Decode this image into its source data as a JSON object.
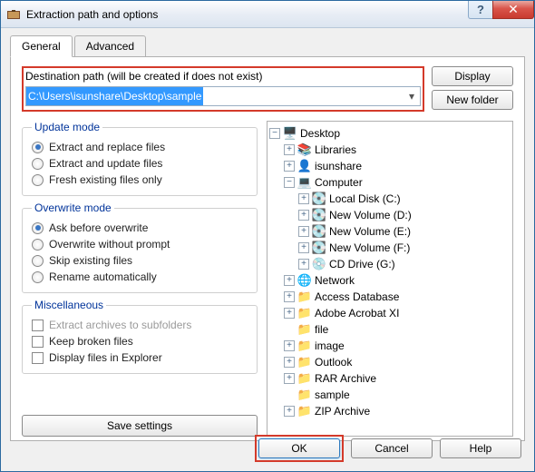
{
  "window": {
    "title": "Extraction path and options"
  },
  "tabs": {
    "general": "General",
    "advanced": "Advanced"
  },
  "dest": {
    "label": "Destination path (will be created if does not exist)",
    "value": "C:\\Users\\isunshare\\Desktop\\sample"
  },
  "buttons": {
    "display": "Display",
    "new_folder": "New folder",
    "save_settings": "Save settings",
    "ok": "OK",
    "cancel": "Cancel",
    "help": "Help"
  },
  "groups": {
    "update": {
      "legend": "Update mode",
      "opt1": "Extract and replace files",
      "opt2": "Extract and update files",
      "opt3": "Fresh existing files only"
    },
    "overwrite": {
      "legend": "Overwrite mode",
      "opt1": "Ask before overwrite",
      "opt2": "Overwrite without prompt",
      "opt3": "Skip existing files",
      "opt4": "Rename automatically"
    },
    "misc": {
      "legend": "Miscellaneous",
      "opt1": "Extract archives to subfolders",
      "opt2": "Keep broken files",
      "opt3": "Display files in Explorer"
    }
  },
  "tree": {
    "desktop": "Desktop",
    "libraries": "Libraries",
    "user": "isunshare",
    "computer": "Computer",
    "drives": {
      "c": "Local Disk (C:)",
      "d": "New Volume (D:)",
      "e": "New Volume (E:)",
      "f": "New Volume (F:)",
      "g": "CD Drive (G:)"
    },
    "network": "Network",
    "folders": {
      "access": "Access Database",
      "acrobat": "Adobe Acrobat XI",
      "file": "file",
      "image": "image",
      "outlook": "Outlook",
      "rar": "RAR Archive",
      "sample": "sample",
      "zip": "ZIP Archive"
    }
  }
}
